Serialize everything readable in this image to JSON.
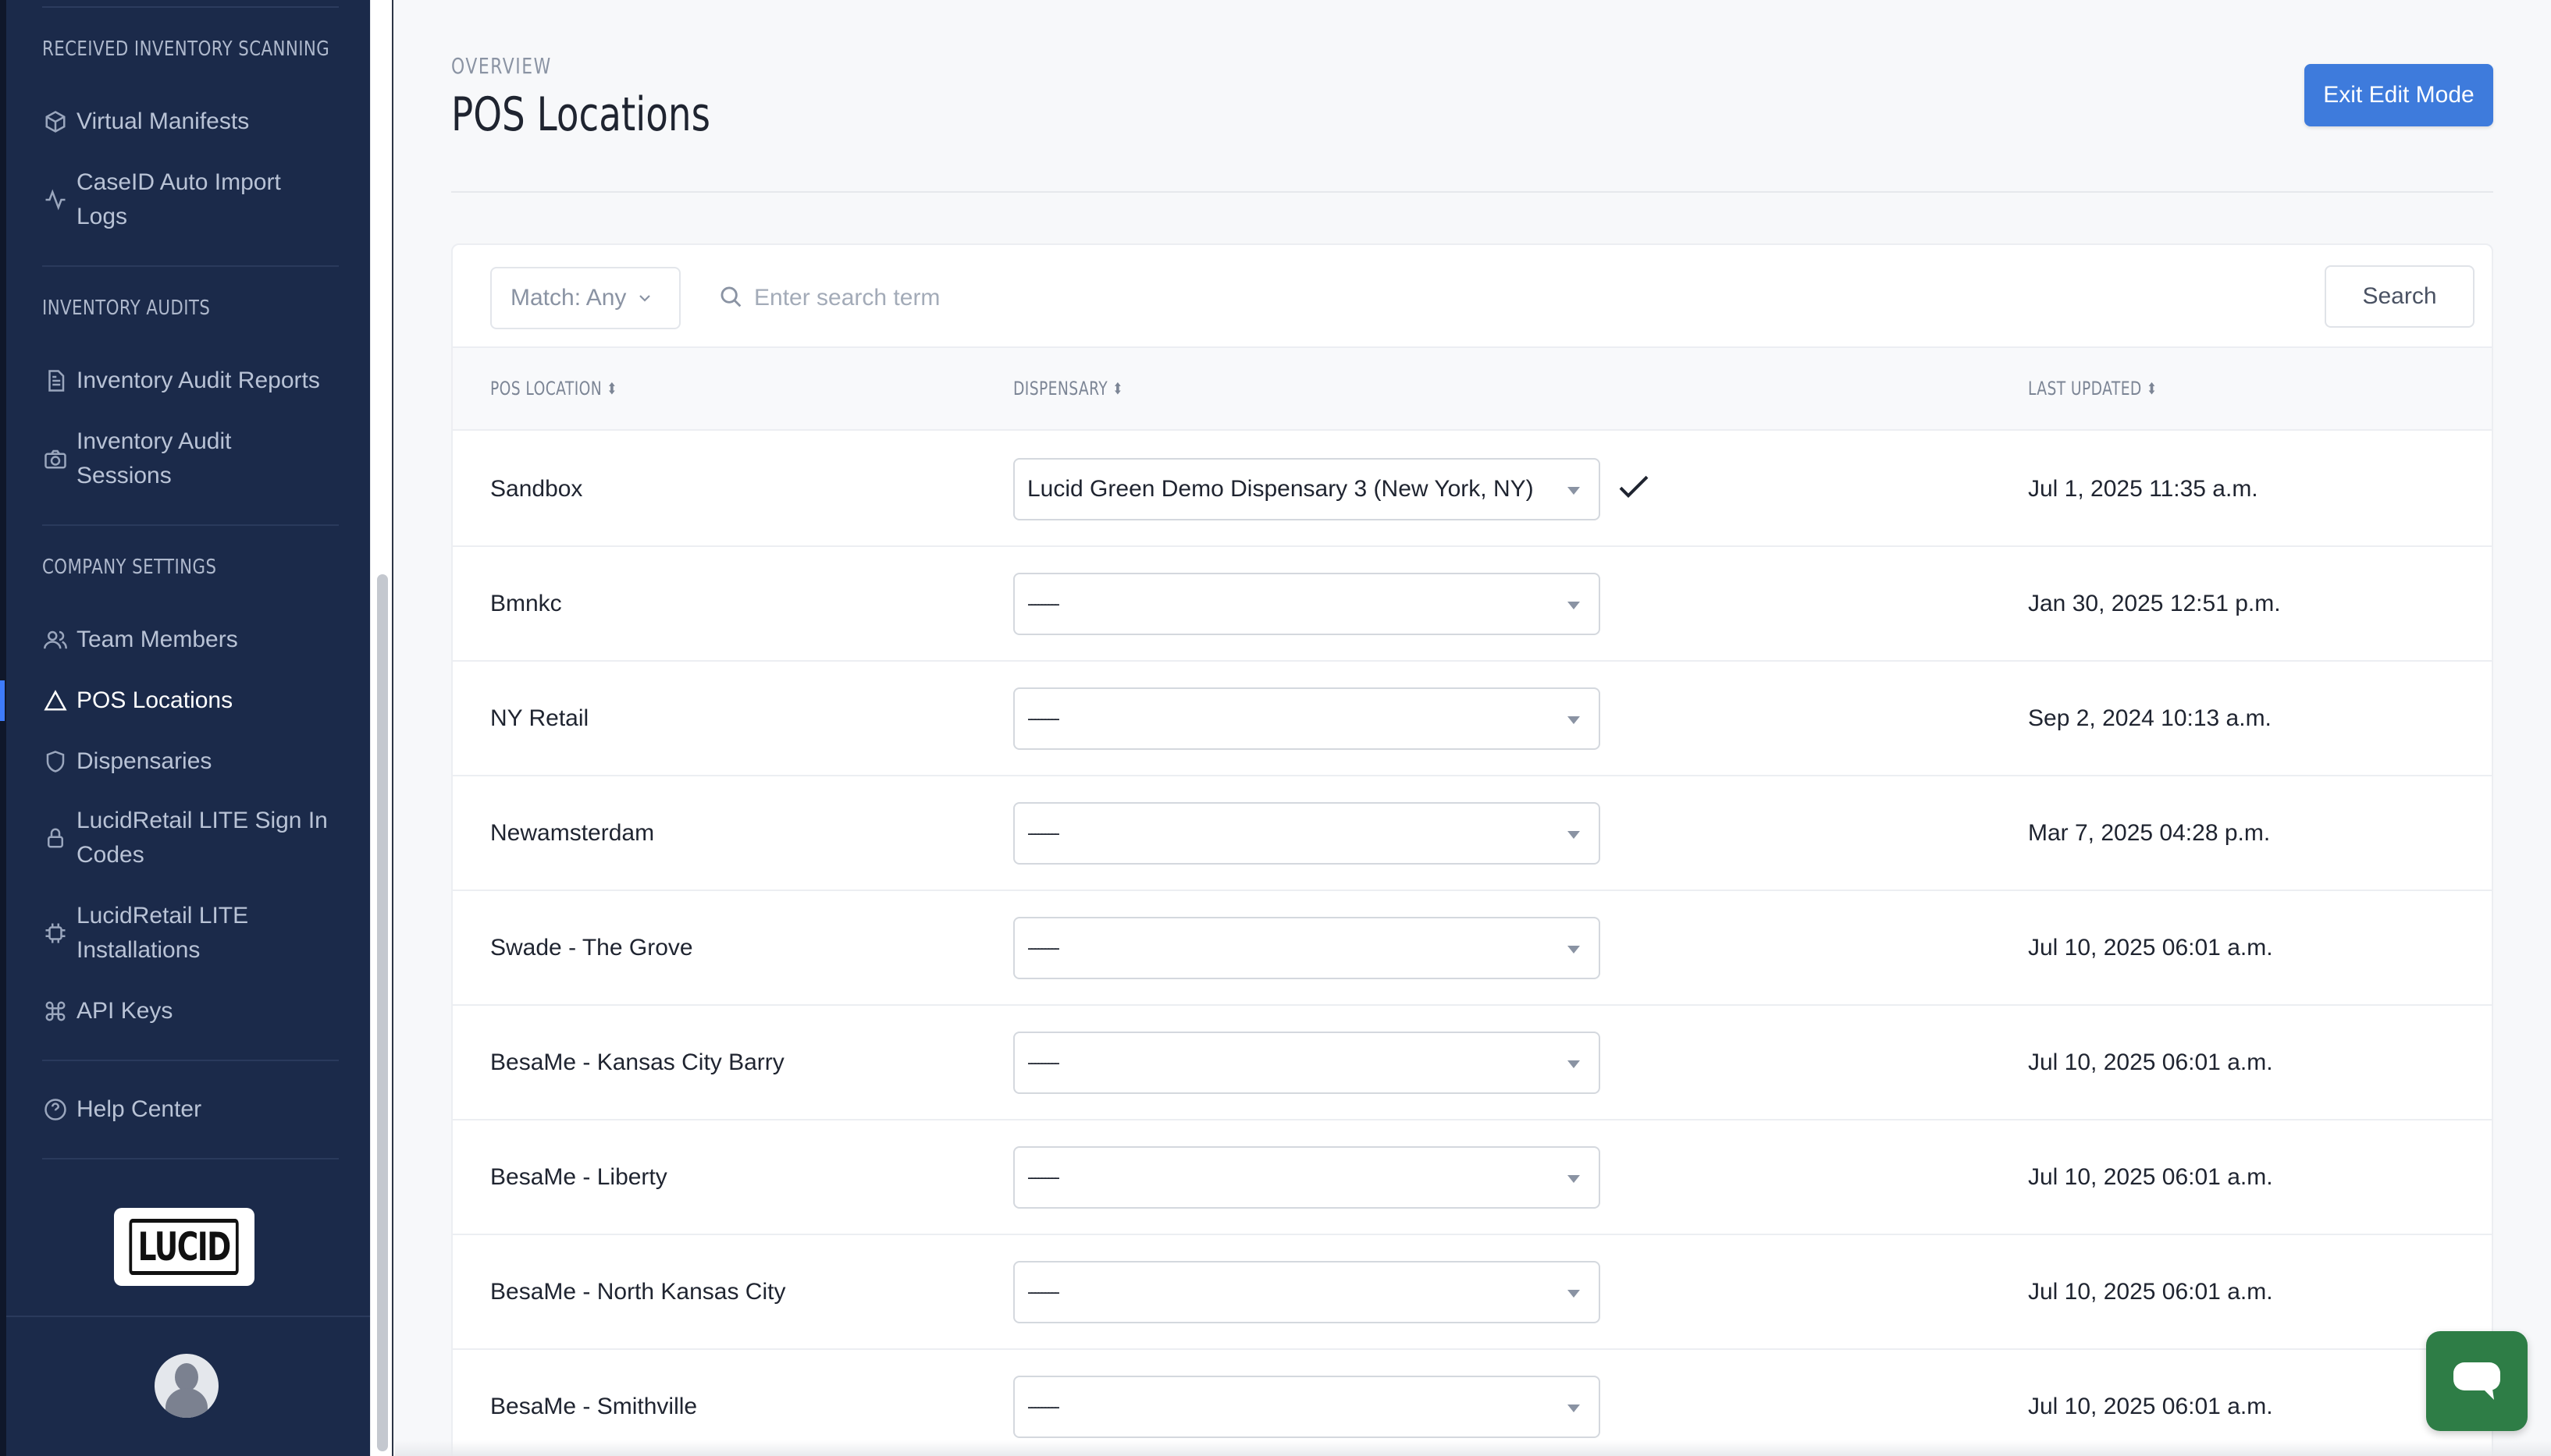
{
  "sidebar": {
    "sections": [
      {
        "title": "RECEIVED INVENTORY SCANNING"
      },
      {
        "title": "INVENTORY AUDITS"
      },
      {
        "title": "COMPANY SETTINGS"
      }
    ],
    "items": [
      {
        "label": "Virtual Manifests",
        "icon": "box-icon"
      },
      {
        "label": "CaseID Auto Import Logs",
        "icon": "activity-icon"
      },
      {
        "label": "Inventory Audit Reports",
        "icon": "document-icon"
      },
      {
        "label": "Inventory Audit Sessions",
        "icon": "camera-icon"
      },
      {
        "label": "Team Members",
        "icon": "users-icon"
      },
      {
        "label": "POS Locations",
        "icon": "triangle-icon",
        "active": true
      },
      {
        "label": "Dispensaries",
        "icon": "shield-icon"
      },
      {
        "label": "LucidRetail LITE Sign In Codes",
        "icon": "lock-icon"
      },
      {
        "label": "LucidRetail LITE Installations",
        "icon": "chip-icon"
      },
      {
        "label": "API Keys",
        "icon": "command-icon"
      },
      {
        "label": "Help Center",
        "icon": "help-circle-icon"
      }
    ],
    "logo_text": "LUCID",
    "accent": "#3e7bfa",
    "background": "#1b2a4a"
  },
  "header": {
    "overline": "OVERVIEW",
    "title": "POS Locations",
    "exit_button": "Exit Edit Mode"
  },
  "toolbar": {
    "match_label": "Match: Any",
    "search_placeholder": "Enter search term",
    "search_button": "Search"
  },
  "table": {
    "columns": [
      "POS LOCATION",
      "DISPENSARY",
      "LAST UPDATED"
    ],
    "rows": [
      {
        "location": "Sandbox",
        "dispensary": "Lucid Green Demo Dispensary 3 (New York, NY)",
        "confirmed": true,
        "updated": "Jul 1, 2025 11:35 a.m."
      },
      {
        "location": "Bmnkc",
        "dispensary": "---------",
        "updated": "Jan 30, 2025 12:51 p.m."
      },
      {
        "location": "NY Retail",
        "dispensary": "---------",
        "updated": "Sep 2, 2024 10:13 a.m."
      },
      {
        "location": "Newamsterdam",
        "dispensary": "---------",
        "updated": "Mar 7, 2025 04:28 p.m."
      },
      {
        "location": "Swade - The Grove",
        "dispensary": "---------",
        "updated": "Jul 10, 2025 06:01 a.m."
      },
      {
        "location": "BesaMe - Kansas City Barry",
        "dispensary": "---------",
        "updated": "Jul 10, 2025 06:01 a.m."
      },
      {
        "location": "BesaMe - Liberty",
        "dispensary": "---------",
        "updated": "Jul 10, 2025 06:01 a.m."
      },
      {
        "location": "BesaMe - North Kansas City",
        "dispensary": "---------",
        "updated": "Jul 10, 2025 06:01 a.m."
      },
      {
        "location": "BesaMe - Smithville",
        "dispensary": "---------",
        "updated": "Jul 10, 2025 06:01 a.m."
      }
    ]
  },
  "colors": {
    "primary_button": "#3e7bdc",
    "chat_button": "#2e7d46"
  }
}
